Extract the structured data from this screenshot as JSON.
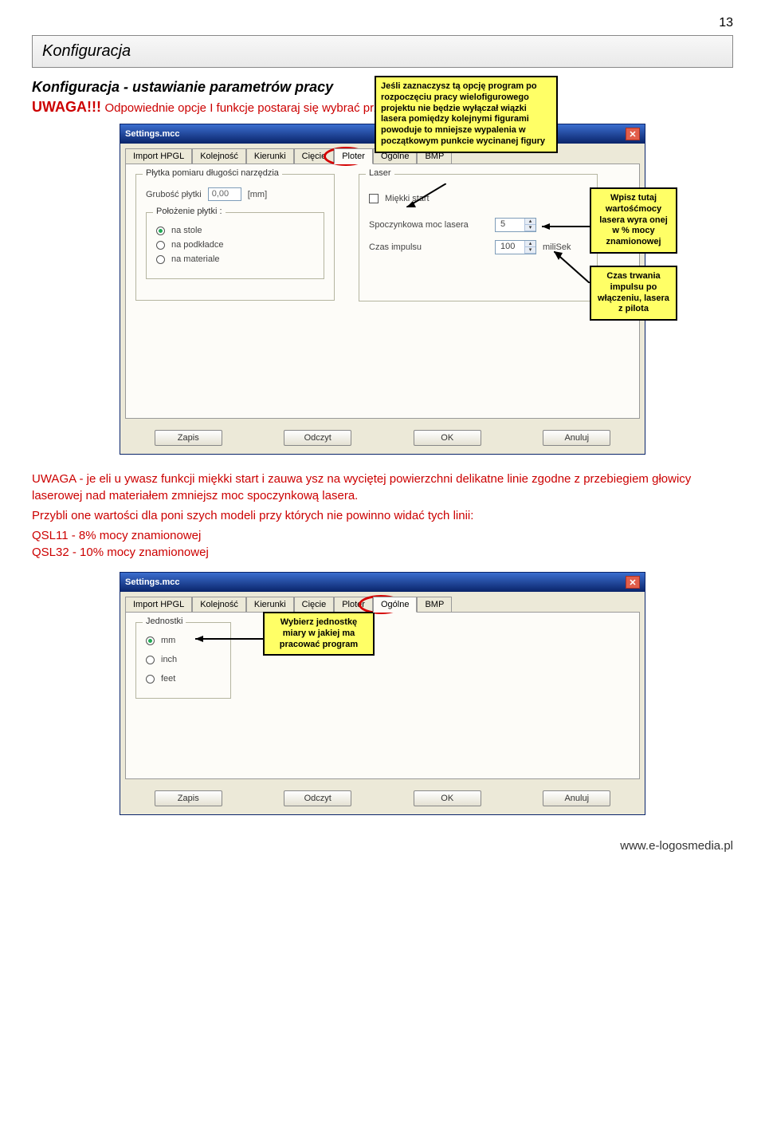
{
  "page_number": "13",
  "section_title": "Konfiguracja",
  "subtitle": "Konfiguracja - ustawianie parametrów pracy",
  "warning_label": "UWAGA!!!",
  "warning_text": "Odpowiednie opcje I funkcje postaraj się wybrać przed otwarciem rysunku",
  "callout1": "Jeśli zaznaczysz tą opcję program po rozpoczęciu pracy wielofigurowego projektu nie będzie wyłączał wiązki lasera pomiędzy kolejnymi figurami powoduje to mniejsze wypalenia w początkowym punkcie wycinanej figury",
  "callout2": "Wpisz tutaj wartośćmocy lasera wyra onej w % mocy znamionowej",
  "callout3": "Czas trwania impulsu po włączeniu, lasera z pilota",
  "window1": {
    "title": "Settings.mcc",
    "tabs": [
      "Import HPGL",
      "Kolejność",
      "Kierunki",
      "Cięcie",
      "Ploter",
      "Ogólne",
      "BMP"
    ],
    "active_tab": 4,
    "group1_legend": "Płytka pomiaru długości narzędzia",
    "grubosc_label": "Grubość płytki",
    "grubosc_value": "0,00",
    "grubosc_unit": "[mm]",
    "group2_legend": "Położenie płytki :",
    "opt1": "na stole",
    "opt2": "na podkładce",
    "opt3": "na materiale",
    "laser_group": "Laser",
    "miekki_label": "Miękki start",
    "spocz_label": "Spoczynkowa moc lasera",
    "spocz_value": "5",
    "czas_label": "Czas impulsu",
    "czas_value": "100",
    "czas_unit": "miliSek"
  },
  "buttons": {
    "zapis": "Zapis",
    "odczyt": "Odczyt",
    "ok": "OK",
    "anuluj": "Anuluj"
  },
  "uwaga_text1": "UWAGA - je  eli u  ywasz funkcji miękki start i zauwa  ysz na wyciętej powierzchni delikatne linie zgodne z przebiegiem głowicy laserowej nad materiałem zmniejsz moc spoczynkową lasera.",
  "uwaga_text2": "Przybli  one wartości dla poni  szych modeli przy których nie powinno widać tych linii:",
  "uwaga_line1": "QSL11 - 8% mocy znamionowej",
  "uwaga_line2": "QSL32 - 10% mocy znamionowej",
  "window2": {
    "title": "Settings.mcc",
    "tabs": [
      "Import HPGL",
      "Kolejność",
      "Kierunki",
      "Cięcie",
      "Ploter",
      "Ogólne",
      "BMP"
    ],
    "active_tab": 5,
    "group_legend": "Jednostki",
    "opt1": "mm",
    "opt2": "inch",
    "opt3": "feet"
  },
  "callout4": "Wybierz jednostkę miary w jakiej ma pracować program",
  "footer": "www.e-logosmedia.pl"
}
